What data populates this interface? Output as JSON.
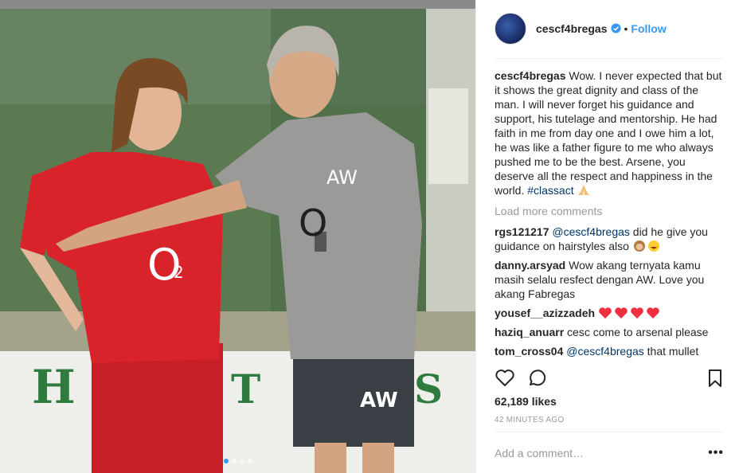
{
  "post": {
    "username": "cescf4bregas",
    "follow_label": "Follow",
    "separator": "•"
  },
  "caption": {
    "user": "cescf4bregas",
    "text": "Wow. I never expected that but it shows the great dignity and class of the man. I will never forget his guidance and support, his tutelage and mentorship. He had faith in me from day one and I owe him a lot, he was like a father figure to me who always pushed me to be the best. Arsene, you deserve all the respect and happiness in the world. ",
    "hashtag": "#classact"
  },
  "load_more": "Load more comments",
  "comments": [
    {
      "user": "rgs121217",
      "mention": "@cescf4bregas",
      "text": " did he give you guidance on hairstyles also "
    },
    {
      "user": "danny.arsyad",
      "mention": "",
      "text": "Wow akang ternyata kamu masih selalu resfect dengan AW. Love you akang Fabregas"
    },
    {
      "user": "yousef__azizzadeh",
      "mention": "",
      "text": ""
    },
    {
      "user": "haziq_anuarr",
      "mention": "",
      "text": "cesc come to arsenal please"
    },
    {
      "user": "tom_cross04",
      "mention": "@cescf4bregas",
      "text": " that mullet"
    }
  ],
  "likes": "62,189 likes",
  "timestamp": "42 MINUTES AGO",
  "add_comment": {
    "placeholder": "Add a comment…"
  },
  "more_label": "•••",
  "colors": {
    "link": "#3897f0",
    "muted": "#999999",
    "heart": "#ed4956",
    "shirt_red": "#d9232b"
  },
  "icons": [
    "verified-badge-icon",
    "heart-icon",
    "comment-icon",
    "bookmark-icon",
    "more-icon"
  ],
  "carousel": {
    "count": 4,
    "active_index": 0
  },
  "photo": {
    "kit_sponsor": "O2",
    "badge": "AW",
    "banner_letters": "H  T  S"
  }
}
